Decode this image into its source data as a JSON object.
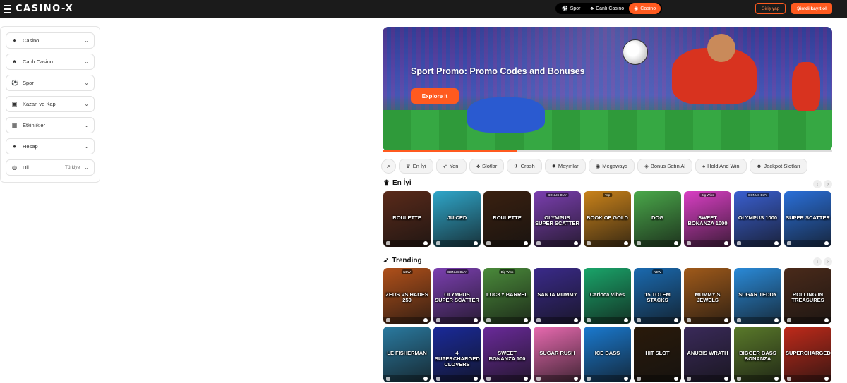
{
  "header": {
    "logo": "CASINO-X",
    "nav": [
      {
        "label": "Spor",
        "icon": "soccer-icon"
      },
      {
        "label": "Canlı Casino",
        "icon": "live-casino-icon"
      },
      {
        "label": "Casino",
        "icon": "casino-icon",
        "active": true
      }
    ],
    "login_label": "Giriş yap",
    "register_label": "Şimdi kayıt ol",
    "accent": "#ff5a1f"
  },
  "sidebar": {
    "items": [
      {
        "label": "Casino",
        "icon": "casino-chip-icon"
      },
      {
        "label": "Canlı Casino",
        "icon": "live-casino-icon"
      },
      {
        "label": "Spor",
        "icon": "soccer-ball-icon"
      },
      {
        "label": "Kazan ve Kap",
        "icon": "gift-icon"
      },
      {
        "label": "Etkinlikler",
        "icon": "calendar-icon"
      },
      {
        "label": "Hesap",
        "icon": "user-icon"
      },
      {
        "label": "Dil",
        "icon": "globe-icon",
        "value": "Türkiye"
      }
    ]
  },
  "banner": {
    "title": "Sport Promo: Promo Codes and Bonuses",
    "button_label": "Explore it",
    "progress": 0.3
  },
  "categories": [
    {
      "label": "En İyi",
      "icon": "crown-icon"
    },
    {
      "label": "Yeni",
      "icon": "rocket-icon"
    },
    {
      "label": "Slotlar",
      "icon": "cherry-icon"
    },
    {
      "label": "Crash",
      "icon": "plane-icon"
    },
    {
      "label": "Mayınlar",
      "icon": "mine-icon"
    },
    {
      "label": "Megaways",
      "icon": "megaways-icon"
    },
    {
      "label": "Bonus Satın Al",
      "icon": "bonus-icon"
    },
    {
      "label": "Hold And Win",
      "icon": "hold-icon"
    },
    {
      "label": "Jackpot Slotları",
      "icon": "jackpot-icon"
    }
  ],
  "sections": [
    {
      "title": "En İyi",
      "icon": "crown-icon",
      "rows": [
        [
          {
            "name": "ROULETTE",
            "badge": "",
            "color": "#5a2a1a"
          },
          {
            "name": "JUICED",
            "badge": "",
            "color": "#2fa6c9"
          },
          {
            "name": "ROULETTE",
            "badge": "",
            "color": "#3a2010"
          },
          {
            "name": "OLYMPUS SUPER SCATTER",
            "badge": "BONUS BUY",
            "color": "#7b3fb0"
          },
          {
            "name": "BOOK OF GOLD",
            "badge": "Top",
            "color": "#c9821a"
          },
          {
            "name": "DOG",
            "badge": "",
            "color": "#4aa84a"
          },
          {
            "name": "SWEET BONANZA 1000",
            "badge": "Big Wins",
            "color": "#d93fc4"
          },
          {
            "name": "OLYMPUS 1000",
            "badge": "BONUS BUY",
            "color": "#3a5fd0"
          },
          {
            "name": "SUPER SCATTER",
            "badge": "",
            "color": "#2a6fd8"
          }
        ]
      ]
    },
    {
      "title": "Trending",
      "icon": "rocket-icon",
      "rows": [
        [
          {
            "name": "ZEUS VS HADES 250",
            "badge": "NEW",
            "color": "#b0501a"
          },
          {
            "name": "OLYMPUS SUPER SCATTER",
            "badge": "BONUS BUY",
            "color": "#7b3fb0"
          },
          {
            "name": "LUCKY BARREL",
            "badge": "Big Wins",
            "color": "#4a8a3a"
          },
          {
            "name": "SANTA MUMMY",
            "badge": "",
            "color": "#3a2a8a"
          },
          {
            "name": "Carioca Vibes",
            "badge": "",
            "color": "#1aa56a"
          },
          {
            "name": "15 TOTEM STACKS",
            "badge": "NEW",
            "color": "#1a6ab0"
          },
          {
            "name": "MUMMY'S JEWELS",
            "badge": "",
            "color": "#a05a1a"
          },
          {
            "name": "SUGAR TEDDY",
            "badge": "",
            "color": "#2a8ad8"
          },
          {
            "name": "ROLLING IN TREASURES",
            "badge": "",
            "color": "#4a2a1a"
          }
        ],
        [
          {
            "name": "LE FISHERMAN",
            "badge": "",
            "color": "#2a7aa0"
          },
          {
            "name": "4 SUPERCHARGED CLOVERS",
            "badge": "",
            "color": "#1a2a9a"
          },
          {
            "name": "SWEET BONANZA 100",
            "badge": "",
            "color": "#6a2a9a"
          },
          {
            "name": "SUGAR RUSH",
            "badge": "",
            "color": "#e86ab0"
          },
          {
            "name": "ICE BASS",
            "badge": "",
            "color": "#1a7ad0"
          },
          {
            "name": "HIT SLOT",
            "badge": "",
            "color": "#2a1a0a"
          },
          {
            "name": "ANUBIS WRATH",
            "badge": "",
            "color": "#3a2a5a"
          },
          {
            "name": "BIGGER BASS BONANZA",
            "badge": "",
            "color": "#5a7a2a"
          },
          {
            "name": "SUPERCHARGED",
            "badge": "",
            "color": "#c02a1a"
          }
        ]
      ]
    }
  ]
}
